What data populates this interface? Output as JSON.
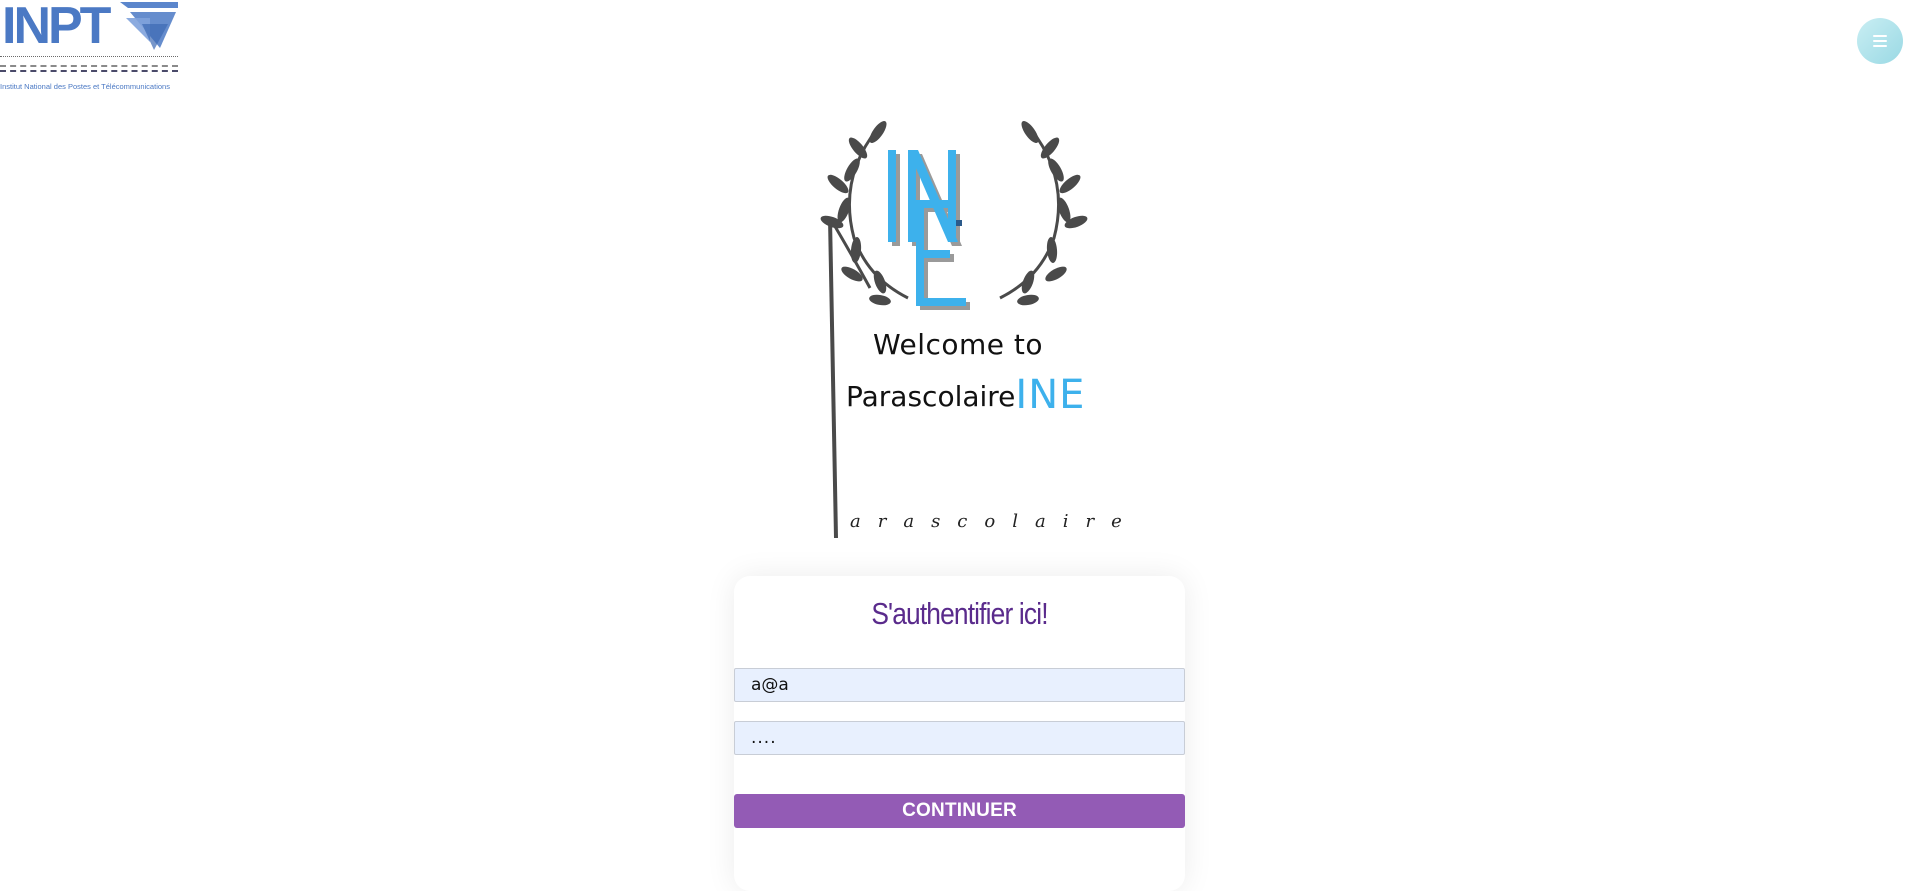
{
  "header": {
    "logo_text": "INPT",
    "logo_subtitle": "Institut National des Postes et Télécommunications",
    "menu_icon": "hamburger-menu-icon"
  },
  "hero": {
    "crest_letters": "INE",
    "welcome_line1": "Welcome to",
    "welcome_line2_prefix": "Parascolaire",
    "welcome_line2_accent": "INE",
    "crest_caption": "arascolaire"
  },
  "login": {
    "title": "S'authentifier ici!",
    "email_value": "a@a",
    "password_value": "....",
    "submit_label": "CONTINUER"
  },
  "colors": {
    "accent_blue": "#3db1ec",
    "title_purple": "#5a2b8c",
    "button_purple": "#935bb5",
    "field_bg": "#e8f0fe"
  }
}
